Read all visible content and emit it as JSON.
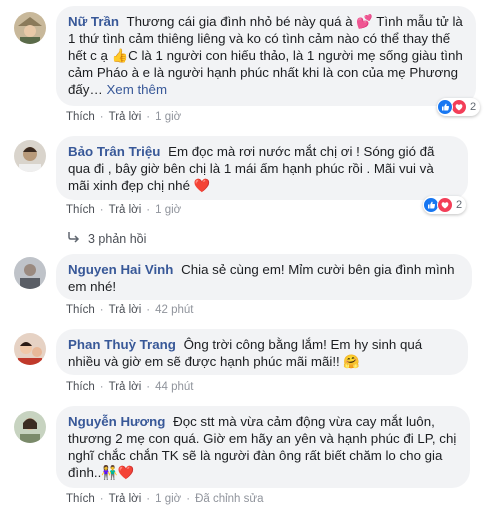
{
  "colors": {
    "link": "#385898",
    "bubble": "#f2f3f5",
    "like": "#1877f2",
    "love": "#f33e58"
  },
  "comments": [
    {
      "author": "Nữ Trần",
      "text": "Thương cái gia đình nhỏ bé này quá à 💕 Tình mẫu tử là 1 thứ tình cảm thiêng liêng và ko có tình cảm nào có thể thay thế hết c ạ 👍C là 1 người con hiếu thảo, là 1 người mẹ sống giàu tình cảm Pháo à e là người hạnh phúc nhất khi là con của mẹ Phương đấy… ",
      "more": "Xem thêm",
      "like": "Thích",
      "reply": "Trả lời",
      "time": "1 giờ",
      "reactions": [
        "like-icon",
        "love-icon"
      ],
      "reaction_count": "2"
    },
    {
      "author": "Bảo Trân Triệu",
      "text": "Em đọc mà rơi nước mắt chị ơi ! Sóng gió đã qua đi , bây giờ bên chị là 1 mái ấm hạnh phúc rồi . Mãi vui và mãi xinh đẹp chị nhé ❤️",
      "like": "Thích",
      "reply": "Trả lời",
      "time": "1 giờ",
      "reactions": [
        "like-icon",
        "love-icon"
      ],
      "reaction_count": "2",
      "replies_label": "3 phản hồi"
    },
    {
      "author": "Nguyen Hai Vinh",
      "text": "Chia sẻ cùng em! Mỉm cười bên gia đình mình em nhé!",
      "like": "Thích",
      "reply": "Trả lời",
      "time": "42 phút"
    },
    {
      "author": "Phan Thuỳ Trang",
      "text": "Ông trời công bằng lắm! Em hy sinh quá nhiều và giờ em sẽ được hạnh phúc mãi mãi!! 🤗",
      "like": "Thích",
      "reply": "Trả lời",
      "time": "44 phút"
    },
    {
      "author": "Nguyễn Hương",
      "text": "Đọc stt mà vừa cảm động vừa cay mắt luôn, thương 2 mẹ con quá. Giờ em hãy an yên và hạnh phúc đi LP, chị nghĩ chắc chắn TK sẽ là người đàn ông rất biết chăm lo cho gia đình..👫❤️",
      "like": "Thích",
      "reply": "Trả lời",
      "time": "1 giờ",
      "edited": "Đã chỉnh sửa"
    }
  ]
}
